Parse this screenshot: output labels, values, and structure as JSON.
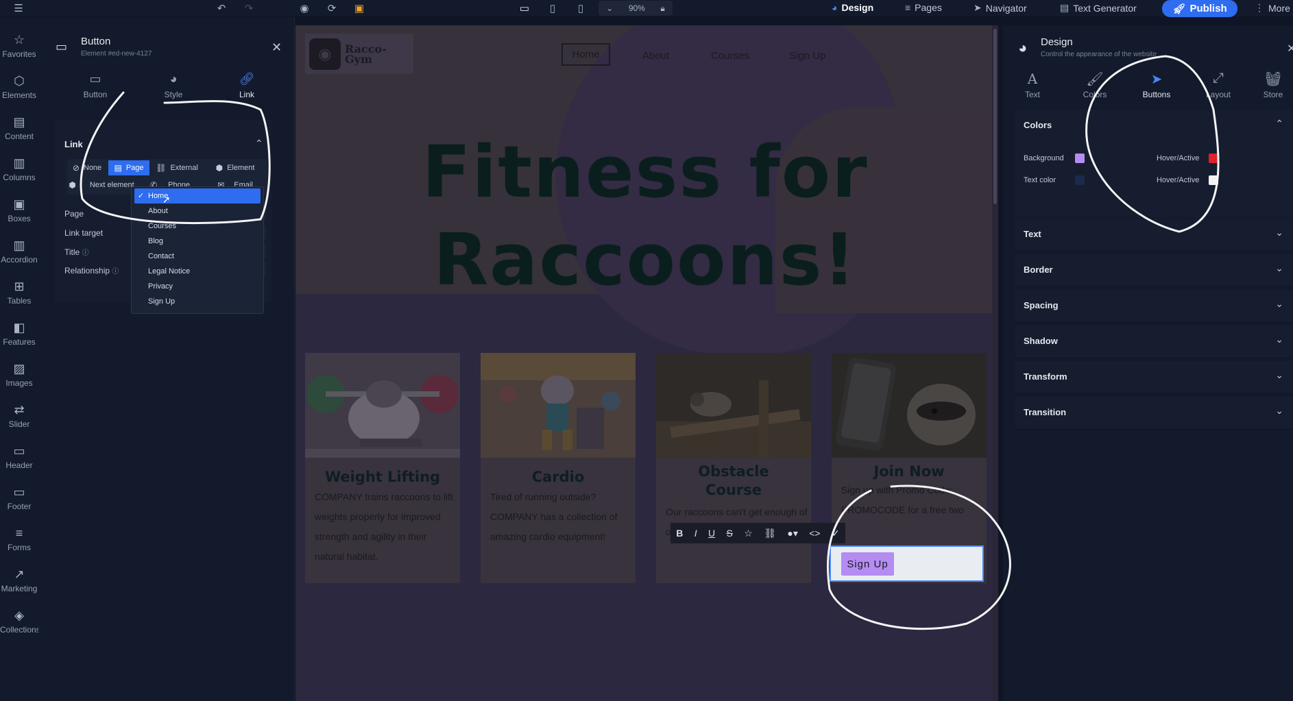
{
  "topbar": {
    "zoom": "90%",
    "design": "Design",
    "pages": "Pages",
    "navigator": "Navigator",
    "text_generator": "Text Generator",
    "publish": "Publish",
    "more": "More"
  },
  "sidebar": {
    "items": [
      {
        "label": "Favorites",
        "icon": "star-icon"
      },
      {
        "label": "Elements",
        "icon": "cube-icon"
      },
      {
        "label": "Content",
        "icon": "document-icon"
      },
      {
        "label": "Columns",
        "icon": "columns-icon"
      },
      {
        "label": "Boxes",
        "icon": "box-icon"
      },
      {
        "label": "Accordion",
        "icon": "accordion-icon"
      },
      {
        "label": "Tables",
        "icon": "table-icon"
      },
      {
        "label": "Features",
        "icon": "features-icon"
      },
      {
        "label": "Images",
        "icon": "image-icon"
      },
      {
        "label": "Slider",
        "icon": "slider-icon"
      },
      {
        "label": "Header",
        "icon": "header-icon"
      },
      {
        "label": "Footer",
        "icon": "footer-icon"
      },
      {
        "label": "Forms",
        "icon": "forms-icon"
      },
      {
        "label": "Marketing",
        "icon": "trend-icon"
      },
      {
        "label": "Collections",
        "icon": "layers-icon"
      }
    ]
  },
  "left_panel": {
    "title": "Button",
    "subtitle": "Element #ed-new-4127",
    "tabs": [
      {
        "label": "Button",
        "active": false
      },
      {
        "label": "Style",
        "active": false
      },
      {
        "label": "Link",
        "active": true
      }
    ],
    "section_title": "Link",
    "link_types": [
      {
        "label": "None",
        "active": false
      },
      {
        "label": "Page",
        "active": true
      },
      {
        "label": "External",
        "active": false
      },
      {
        "label": "Element",
        "active": false
      },
      {
        "label": "Next element",
        "active": false
      },
      {
        "label": "Phone",
        "active": false
      },
      {
        "label": "Email",
        "active": false
      }
    ],
    "fields": {
      "page": "Page",
      "link_target": "Link target",
      "title": "Title",
      "relationship": "Relationship"
    },
    "page_options": [
      "Home",
      "About",
      "Courses",
      "Blog",
      "Contact",
      "Legal Notice",
      "Privacy",
      "Sign Up"
    ],
    "selected_page": "Home"
  },
  "site": {
    "logo_text": "Racco-Gym",
    "nav": [
      "Home",
      "About",
      "Courses",
      "Sign Up"
    ],
    "hero_title": "Fitness for Raccoons!",
    "cards": [
      {
        "title": "Weight Lifting",
        "body": "COMPANY trains raccoons to lift weights properly for improved strength and agility in their natural habitat."
      },
      {
        "title": "Cardio",
        "body": "Tired of running outside? COMPANY has a collection of amazing cardio equipment!"
      },
      {
        "title": "Obstacle Course",
        "body": "Our raccoons can't get enough of o... See you there!"
      },
      {
        "title": "Join Now",
        "body": "Sign up with Promo Code: PROMOCODE for a free two"
      }
    ],
    "signup_button": "Sign Up"
  },
  "right_panel": {
    "title": "Design",
    "subtitle": "Control the appearance of the website",
    "tabs": [
      {
        "label": "Text",
        "active": false
      },
      {
        "label": "Colors",
        "active": false
      },
      {
        "label": "Buttons",
        "active": true
      },
      {
        "label": "Layout",
        "active": false
      },
      {
        "label": "Store",
        "active": false
      }
    ],
    "sections": [
      "Colors",
      "Text",
      "Border",
      "Spacing",
      "Shadow",
      "Transform",
      "Transition"
    ],
    "colors": {
      "background_label": "Background",
      "hover_active_label": "Hover/Active",
      "text_color_label": "Text color",
      "background": "#b48cf2",
      "background_hover": "#e0202a",
      "text_color": "#1a2a4a",
      "text_hover": "#f2f2f2"
    }
  },
  "accent": "#2e6cf0"
}
